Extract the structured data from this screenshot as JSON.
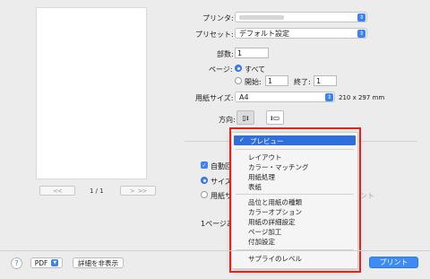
{
  "preview": {
    "page_indicator": "1 / 1",
    "first_label": "<<",
    "prev_label": "<",
    "next_label": ">",
    "last_label": ">>"
  },
  "printer": {
    "label": "プリンタ:",
    "value": ""
  },
  "preset": {
    "label": "プリセット:",
    "value": "デフォルト設定"
  },
  "copies": {
    "label": "部数:",
    "value": "1"
  },
  "pages": {
    "label": "ページ:",
    "all_label": "すべて",
    "from_label": "開始:",
    "from_value": "1",
    "to_label": "終了:",
    "to_value": "1"
  },
  "paper_size": {
    "label": "用紙サイズ:",
    "value": "A4",
    "dimensions": "210 x 297 mm"
  },
  "orientation": {
    "label": "方向:"
  },
  "options": {
    "auto_rotate": "自動回転",
    "fit_size": "サイズ調",
    "paper_size_option": "用紙サイ",
    "partial_right": "ント",
    "pages_per_sheet": "1ページあた"
  },
  "menu": {
    "selected": "プレビュー",
    "group1": [
      "レイアウト",
      "カラー・マッチング",
      "用紙処理",
      "表紙"
    ],
    "group2": [
      "品位と用紙の種類",
      "カラーオプション",
      "用紙の詳細設定",
      "ページ加工",
      "付加設定"
    ],
    "group3": [
      "サプライのレベル"
    ]
  },
  "bottom": {
    "help": "?",
    "pdf": "PDF",
    "hide_details": "詳細を非表示",
    "print": "プリント"
  },
  "colors": {
    "accent": "#3b82f6",
    "highlight_frame": "#e0241c",
    "menu_selection": "#2f6fdd"
  }
}
